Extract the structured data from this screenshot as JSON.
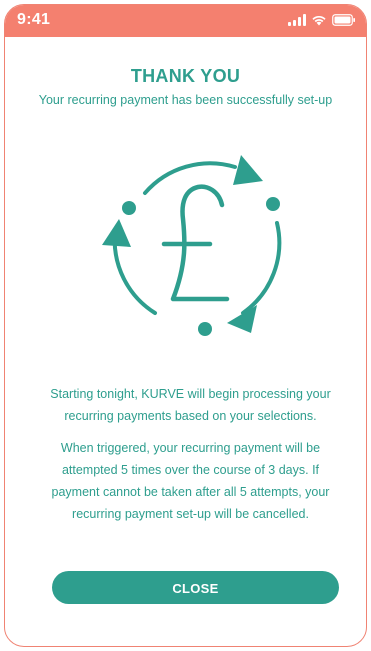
{
  "status_bar": {
    "time": "9:41",
    "icons": [
      "signal-icon",
      "wifi-icon",
      "battery-icon"
    ],
    "background_color": "#f4806f"
  },
  "content": {
    "title": "THANK YOU",
    "subtitle": "Your recurring payment has been successfully set-up",
    "hero_icon": "pound-recurring-icon",
    "paragraph_1": "Starting tonight, KURVE will begin processing your recurring payments based on your selections.",
    "paragraph_2": "When triggered, your recurring payment will be attempted 5 times over the course of 3 days. If payment cannot be taken after all 5 attempts, your recurring payment set-up will be cancelled."
  },
  "actions": {
    "close_label": "CLOSE"
  },
  "colors": {
    "accent": "#2e9e8e",
    "frame_border": "#f08373"
  }
}
